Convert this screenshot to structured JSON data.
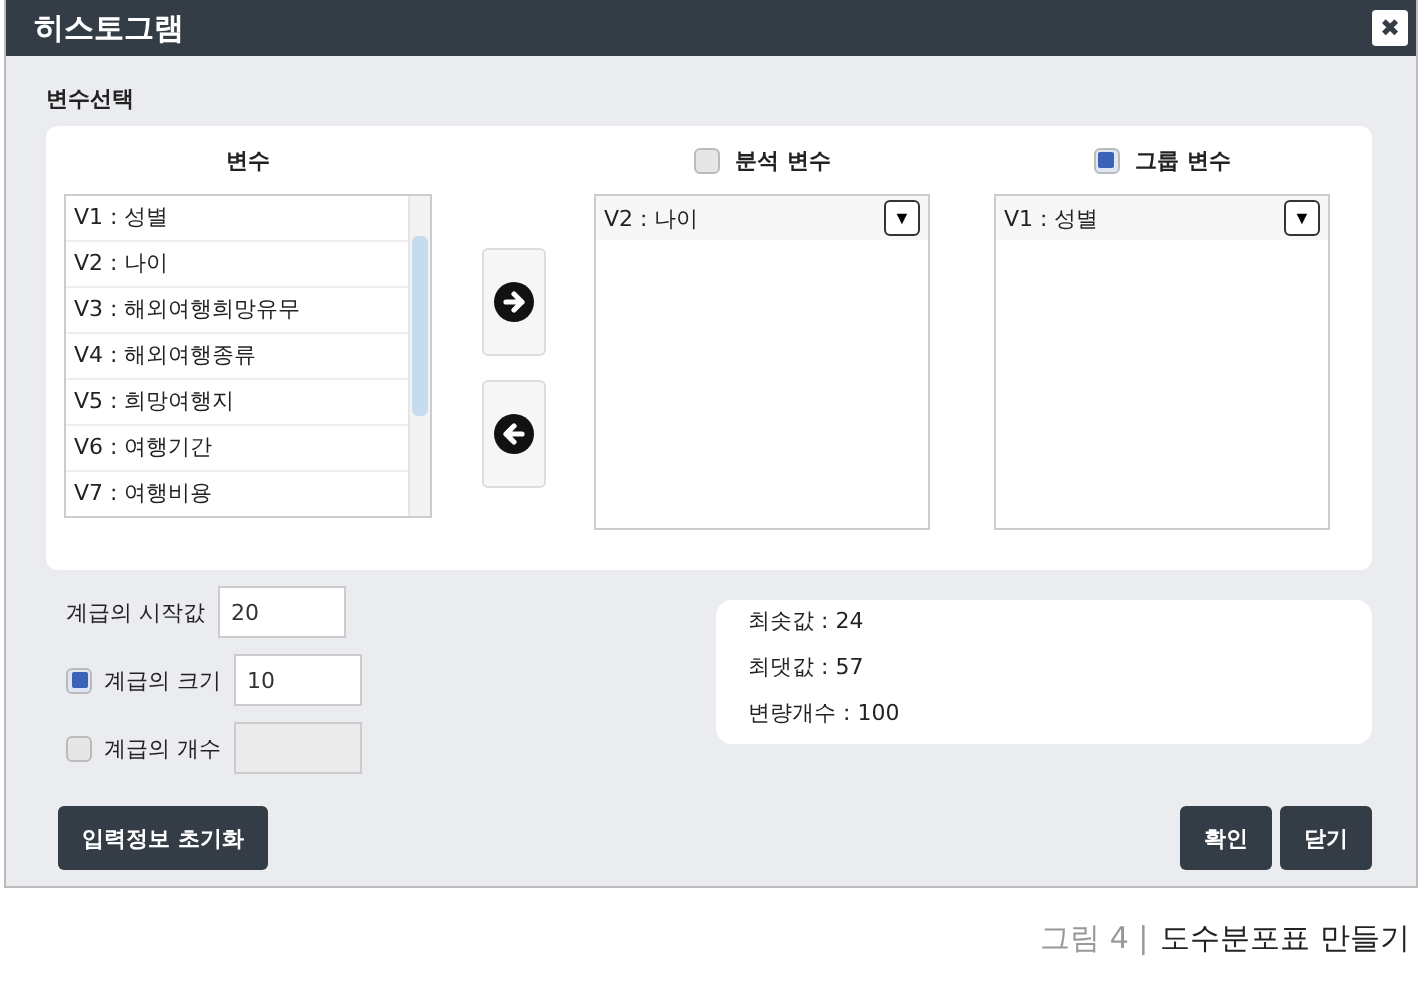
{
  "window": {
    "title": "히스토그램",
    "close": "✖"
  },
  "section_label": "변수선택",
  "variables": {
    "heading": "변수",
    "items": [
      {
        "label": "V1 : 성별",
        "selected": false
      },
      {
        "label": "V2 : 나이",
        "selected": false
      },
      {
        "label": "V3 : 해외여행희망유무",
        "selected": false
      },
      {
        "label": "V4 : 해외여행종류",
        "selected": false
      },
      {
        "label": "V5 : 희망여행지",
        "selected": false
      },
      {
        "label": "V6 : 여행기간",
        "selected": false
      },
      {
        "label": "V7 : 여행비용",
        "selected": false
      }
    ]
  },
  "targets": [
    {
      "label": "분석 변수",
      "checked": false,
      "value": "V2 : 나이",
      "toggle": "▼"
    },
    {
      "label": "그룹 변수",
      "checked": true,
      "value": "V1 : 성별",
      "toggle": "▼"
    }
  ],
  "class_settings": [
    {
      "label": "계급의 시작값",
      "kind": "plain",
      "value": "20",
      "disabled": false
    },
    {
      "label": "계급의 크기",
      "kind": "checkbox",
      "checked": true,
      "value": "10",
      "disabled": false
    },
    {
      "label": "계급의 개수",
      "kind": "checkbox",
      "checked": false,
      "disabled": true
    }
  ],
  "stats": [
    "최솟값 : 24",
    "최댓값 : 57",
    "변량개수 : 100"
  ],
  "buttons": {
    "reset": "입력정보 초기화",
    "confirm": "확인",
    "close": "닫기"
  },
  "caption": {
    "label": "그림 4 |",
    "title": "도수분포표 만들기"
  }
}
